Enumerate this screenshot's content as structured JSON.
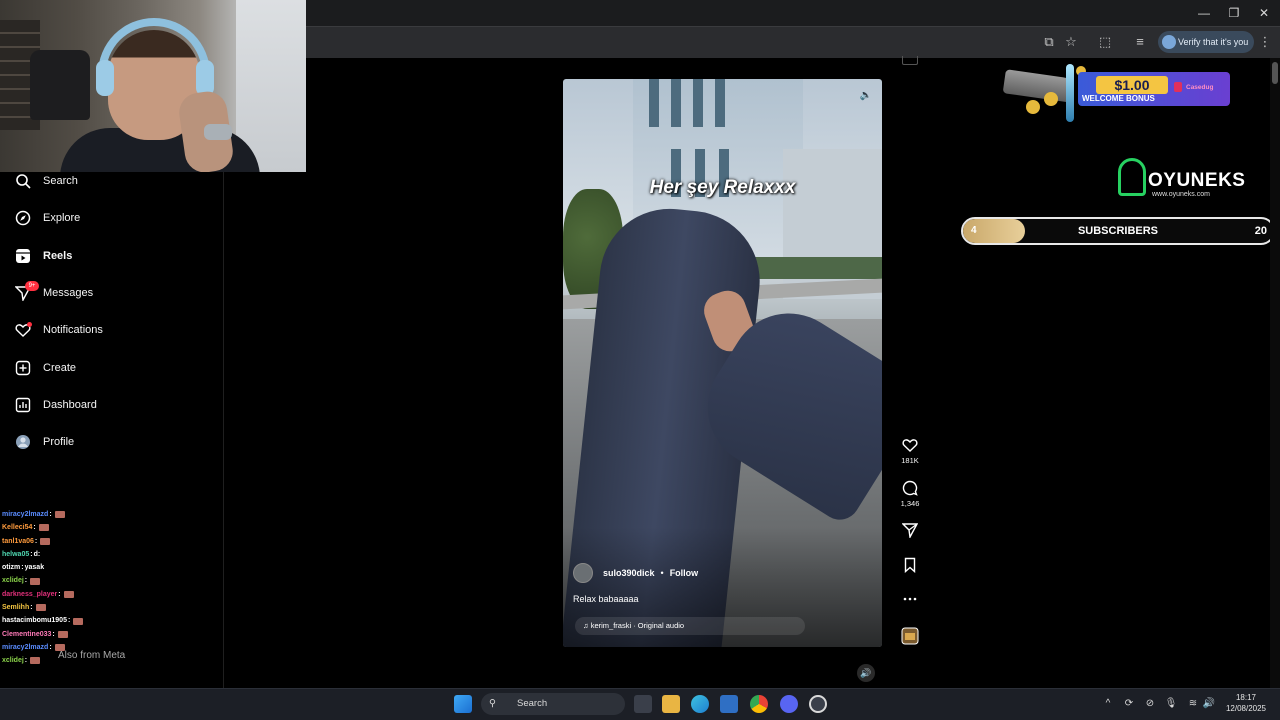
{
  "browser": {
    "verify_label": "Verify that it's you",
    "window_controls": [
      "—",
      "❐",
      "✕"
    ]
  },
  "nav": {
    "items": [
      {
        "label": "Search",
        "icon": "search-icon"
      },
      {
        "label": "Explore",
        "icon": "compass-icon"
      },
      {
        "label": "Reels",
        "icon": "reels-icon"
      },
      {
        "label": "Messages",
        "icon": "messenger-icon",
        "badge": "9+"
      },
      {
        "label": "Notifications",
        "icon": "heart-icon"
      },
      {
        "label": "Create",
        "icon": "plus-square-icon"
      },
      {
        "label": "Dashboard",
        "icon": "chart-icon"
      },
      {
        "label": "Profile",
        "icon": "avatar-icon"
      }
    ],
    "meta_text": "Also from Meta"
  },
  "chat": [
    {
      "user": "miracy2lmazd",
      "msg": "",
      "color": "#5a8cff"
    },
    {
      "user": "Kelleci54",
      "msg": "",
      "color": "#ff9b3d"
    },
    {
      "user": "tanl1va06",
      "msg": "",
      "color": "#ff9b3d"
    },
    {
      "user": "helwa05",
      "msg": "d:",
      "color": "#4fd6b0"
    },
    {
      "user": "otizm",
      "msg": "yasak",
      "color": "#ffffff"
    },
    {
      "user": "xclidej",
      "msg": "",
      "color": "#8bd34a"
    },
    {
      "user": "darkness_player",
      "msg": "",
      "color": "#e0307a"
    },
    {
      "user": "Semlihh",
      "msg": "",
      "color": "#f4c542"
    },
    {
      "user": "hastacimbomu1905",
      "msg": "",
      "color": "#ffffff"
    },
    {
      "user": "Clementine033",
      "msg": "",
      "color": "#ff7ab8"
    },
    {
      "user": "miracy2lmazd",
      "msg": "",
      "color": "#5a8cff"
    },
    {
      "user": "xclidej",
      "msg": "",
      "color": "#8bd34a"
    }
  ],
  "reel": {
    "overlay_text": "Her şey Relaxxx",
    "username": "sulo390dick",
    "separator": "•",
    "follow_label": "Follow",
    "description": "Relax babaaaaa",
    "audio": "kerim_fraski · Original audio"
  },
  "actions": {
    "likes": "181K",
    "comments": "1,346"
  },
  "promo": {
    "amount": "$1.00",
    "label": "WELCOME BONUS",
    "brand": "Casedug"
  },
  "brand": {
    "name": "OYUNEKS",
    "url": "www.oyuneks.com"
  },
  "subgoal": {
    "current": "4",
    "label": "SUBSCRIBERS",
    "goal": "20",
    "progress": 0.2
  },
  "taskbar": {
    "search_label": "Search",
    "time": "18:17",
    "date": "12/08/2025"
  }
}
